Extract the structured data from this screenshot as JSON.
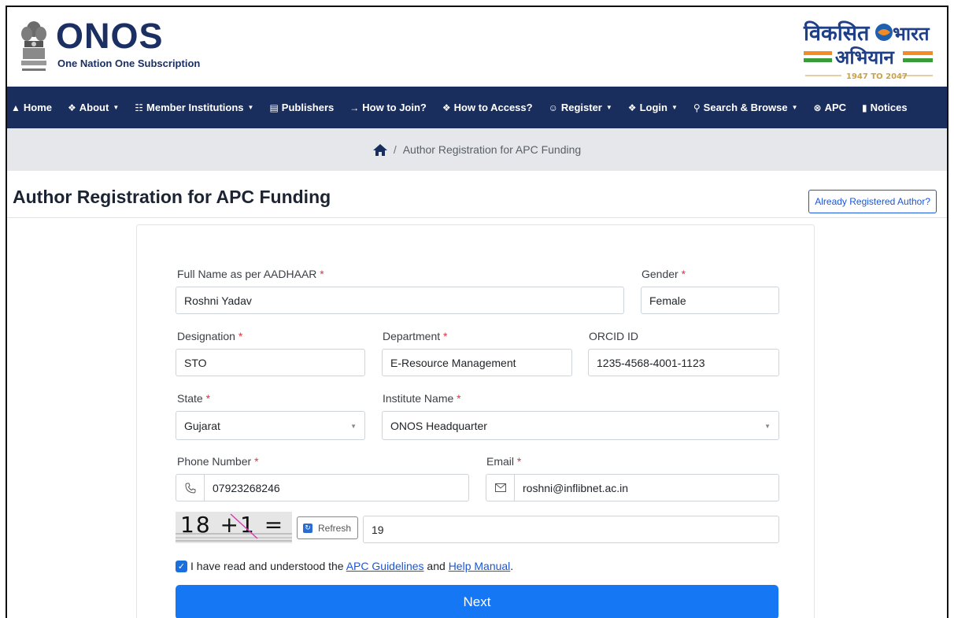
{
  "header": {
    "brand_name": "ONOS",
    "tagline_one": "One",
    "tagline_nation": " Nation",
    "tagline_one2": " One",
    "tagline_sub": " Subscription",
    "viksit_line1": "विकसित",
    "viksit_line1b": "भारत",
    "viksit_line2": "अभियान",
    "viksit_years": "1947 TO 2047"
  },
  "nav": [
    {
      "label": "Home",
      "icon": "home-icon",
      "caret": false
    },
    {
      "label": "About",
      "icon": "info-icon",
      "caret": true
    },
    {
      "label": "Member Institutions",
      "icon": "institution-icon",
      "caret": true
    },
    {
      "label": "Publishers",
      "icon": "book-icon",
      "caret": false
    },
    {
      "label": "How to Join?",
      "icon": "login-arrow-icon",
      "caret": false
    },
    {
      "label": "How to Access?",
      "icon": "question-icon",
      "caret": false
    },
    {
      "label": "Register",
      "icon": "user-plus-icon",
      "caret": true
    },
    {
      "label": "Login",
      "icon": "info-icon",
      "caret": true
    },
    {
      "label": "Search & Browse",
      "icon": "search-icon",
      "caret": true
    },
    {
      "label": "APC",
      "icon": "apc-icon",
      "caret": false
    },
    {
      "label": "Notices",
      "icon": "notice-icon",
      "caret": false
    }
  ],
  "breadcrumb": {
    "sep": "/",
    "current": "Author Registration for APC Funding"
  },
  "page": {
    "title": "Author Registration for APC Funding",
    "already_registered": "Already Registered Author?"
  },
  "form": {
    "required_mark": "*",
    "full_name": {
      "label": "Full Name as per AADHAAR",
      "value": "Roshni Yadav"
    },
    "gender": {
      "label": "Gender",
      "value": "Female"
    },
    "designation": {
      "label": "Designation",
      "value": "STO"
    },
    "department": {
      "label": "Department",
      "value": "E-Resource Management"
    },
    "orcid": {
      "label": "ORCID ID",
      "value": "1235-4568-4001-1123"
    },
    "state": {
      "label": "State",
      "value": "Gujarat"
    },
    "institute": {
      "label": "Institute Name",
      "value": "ONOS Headquarter"
    },
    "phone": {
      "label": "Phone Number",
      "value": "07923268246"
    },
    "email": {
      "label": "Email",
      "value": "roshni@inflibnet.ac.in"
    },
    "captcha_text": "18 +1 =",
    "refresh_label": "Refresh",
    "captcha_answer": "19",
    "consent_prefix": "I have read and understood the ",
    "consent_link1": "APC Guidelines",
    "consent_and": " and ",
    "consent_link2": "Help Manual",
    "consent_suffix": ".",
    "next_label": "Next"
  },
  "colors": {
    "navbar": "#1a2e5e",
    "primary": "#1677f5",
    "link": "#1a56db",
    "required": "#dc3545"
  }
}
